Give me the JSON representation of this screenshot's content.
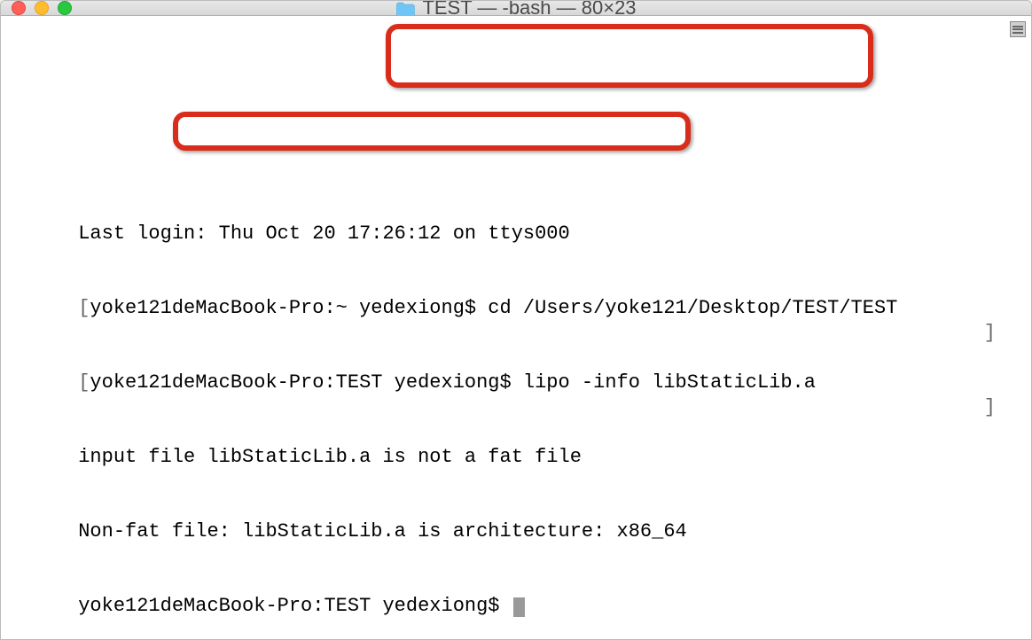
{
  "titlebar": {
    "title": "TEST — -bash — 80×23"
  },
  "terminal": {
    "lines": [
      {
        "prefix": "",
        "text": "Last login: Thu Oct 20 17:26:12 on ttys000",
        "hasRightBracket": false
      },
      {
        "prefix": "[",
        "text": "yoke121deMacBook-Pro:~ yedexiong$ cd /Users/yoke121/Desktop/TEST/TEST",
        "hasRightBracket": true
      },
      {
        "prefix": "[",
        "text": "yoke121deMacBook-Pro:TEST yedexiong$ lipo -info libStaticLib.a",
        "hasRightBracket": true
      },
      {
        "prefix": "",
        "text": "input file libStaticLib.a is not a fat file",
        "hasRightBracket": false
      },
      {
        "prefix": "",
        "text": "Non-fat file: libStaticLib.a is architecture: x86_64",
        "hasRightBracket": false
      }
    ],
    "prompt": "yoke121deMacBook-Pro:TEST yedexiong$ "
  },
  "annotations": {
    "command1": "cd /Users/yoke121/Desktop/TEST/TEST",
    "command2": "lipo -info libStaticLib.a",
    "highlighted_output": "libStaticLib.a is architecture: x86_64"
  }
}
